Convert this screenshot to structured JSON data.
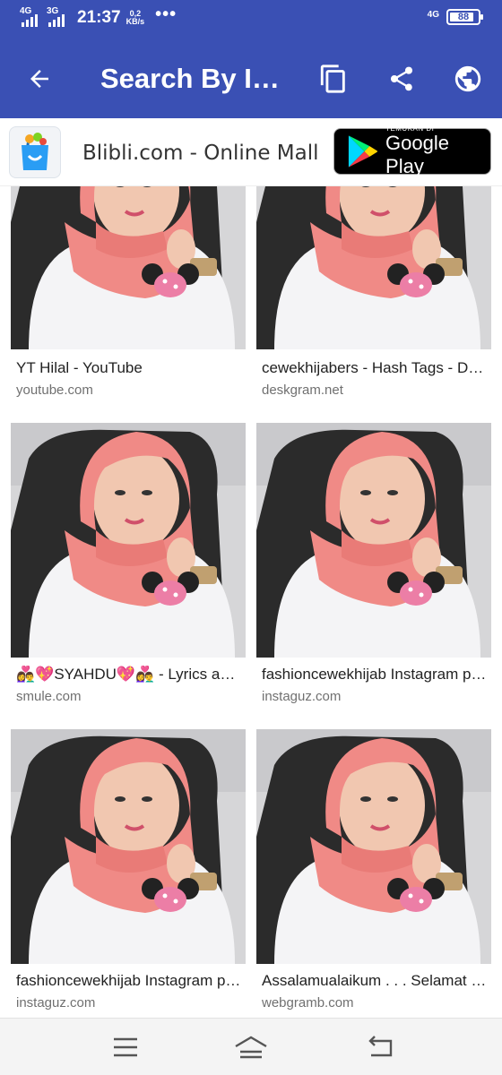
{
  "status_bar": {
    "net1": "4G",
    "net2": "3G",
    "time": "21:37",
    "speed_value": "0,2",
    "speed_unit": "KB/s",
    "dots": "•••",
    "net_right": "4G",
    "battery": "88"
  },
  "app_bar": {
    "title": "Search By Image",
    "back_icon": "arrow-left",
    "actions": [
      "copy-icon",
      "share-icon",
      "globe-icon"
    ]
  },
  "ad": {
    "title": "Blibli.com - Online Mall",
    "button_small": "TEMUKAN DI",
    "button_big": "Google Play"
  },
  "results": [
    {
      "title": "YT Hilal - YouTube",
      "site": "youtube.com"
    },
    {
      "title": "cewekhijabers - Hash Tags - Deskgram",
      "site": "deskgram.net"
    },
    {
      "title": "👩‍❤️‍👨💖SYAHDU💖👩‍❤️‍👨 - Lyrics and Music",
      "site": "smule.com"
    },
    {
      "title": "fashioncewekhijab Instagram posts",
      "site": "instaguz.com"
    },
    {
      "title": "fashioncewekhijab Instagram posts",
      "site": "instaguz.com"
    },
    {
      "title": "Assalamualaikum . . . Selamat pagi",
      "site": "webgramb.com"
    }
  ],
  "nav_bar": {
    "icons": [
      "menu-icon",
      "home-icon",
      "back-icon"
    ]
  },
  "colors": {
    "primary": "#3a50b4",
    "scarf": "#f08a86",
    "chair": "#2b2b2b",
    "shirt": "#f4f4f6"
  }
}
